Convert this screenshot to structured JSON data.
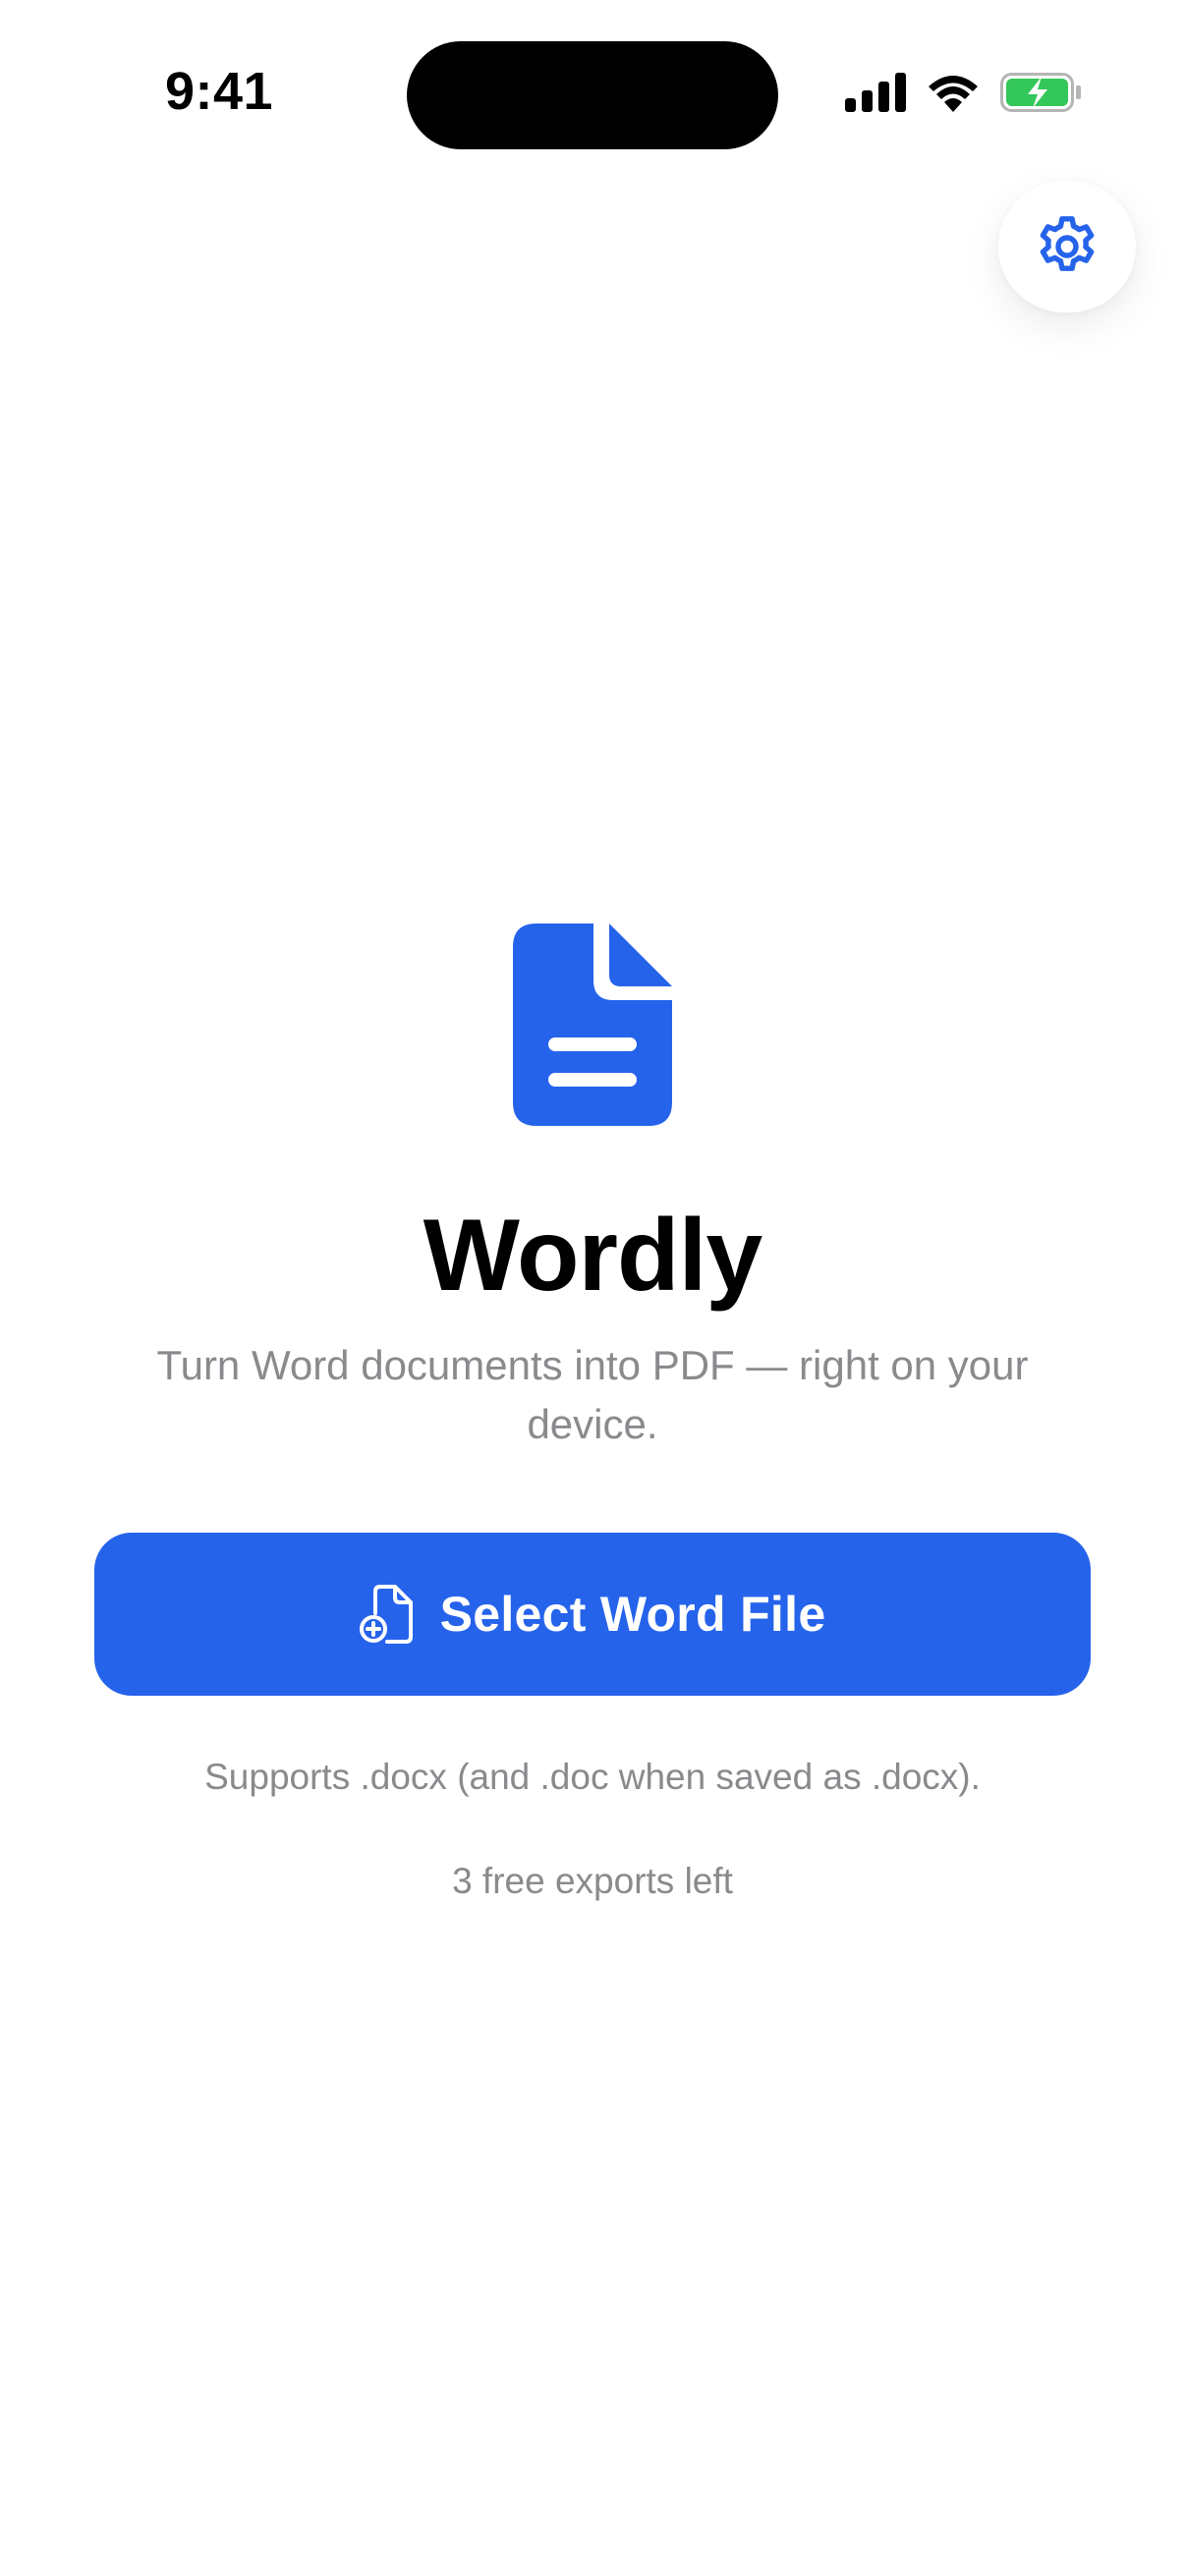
{
  "status_bar": {
    "time": "9:41"
  },
  "app": {
    "title": "Wordly",
    "subtitle": "Turn Word documents into PDF — right on your device.",
    "primary_button_label": "Select Word File",
    "supports_note": "Supports .docx (and .doc when saved as .docx).",
    "exports_left": "3 free exports left"
  },
  "icons": {
    "settings": "gear-icon",
    "hero": "document-icon",
    "button": "document-add-icon"
  },
  "colors": {
    "accent": "#2563eb",
    "secondary_text": "#8a8a8e",
    "battery_green": "#34c759"
  }
}
